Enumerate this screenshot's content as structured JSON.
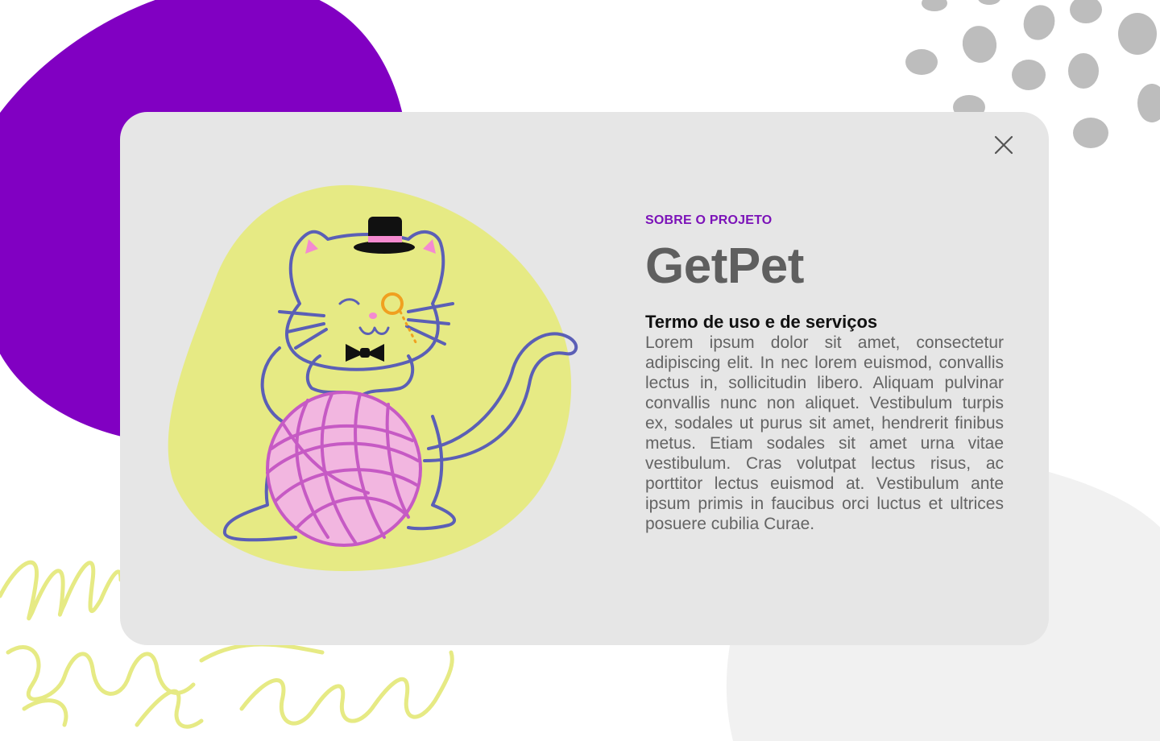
{
  "modal": {
    "eyebrow": "SOBRE O PROJETO",
    "title": "GetPet",
    "subtitle": "Termo de uso e de serviços",
    "body": "Lorem ipsum dolor sit amet, consectetur adipiscing elit. In nec lorem euismod, convallis lectus in, sollicitudin libero. Aliquam pulvinar convallis nunc non aliquet. Vestibulum turpis ex, sodales ut purus sit amet, hendrerit finibus metus. Etiam sodales sit amet urna vitae vestibulum. Cras volutpat lectus risus, ac porttitor lectus euismod at. Vestibulum ante ipsum primis in faucibus orci luctus et ultrices posuere cubilia Curae.",
    "close_icon": "close-icon"
  },
  "illustration": {
    "subject": "cat-with-top-hat-monocle-and-yarn-ball"
  },
  "colors": {
    "accent_purple": "#7b12b8",
    "blob_purple": "#8100c2",
    "modal_bg": "#e6e6e6",
    "title_gray": "#5f5f5f",
    "body_gray": "#646464",
    "yellow_blob": "#e6ea84",
    "cat_outline": "#5b5fb6",
    "yarn_pink": "#c65ac4",
    "dots_gray": "#bdbdbd"
  }
}
